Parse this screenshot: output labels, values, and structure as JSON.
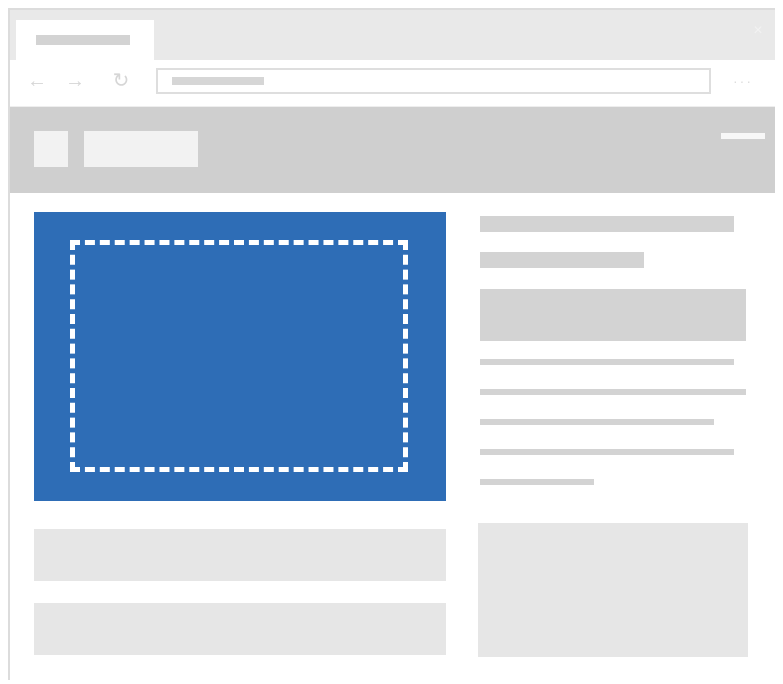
{
  "colors": {
    "hero_blue": "#2e6db6",
    "header_gray": "#cfcfcf",
    "tabstrip_gray": "#e9e9e9",
    "placeholder_gray": "#d3d3d3",
    "block_gray": "#e6e6e6"
  },
  "icons": {
    "back": "←",
    "forward": "→",
    "refresh": "↻",
    "close": "×",
    "more": "···"
  }
}
